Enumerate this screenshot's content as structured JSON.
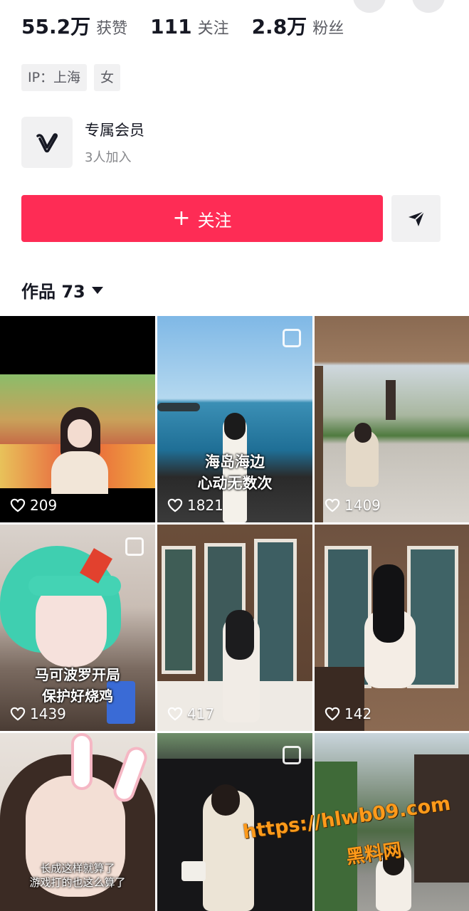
{
  "stats": [
    {
      "value": "55.2万",
      "label": "获赞"
    },
    {
      "value": "111",
      "label": "关注"
    },
    {
      "value": "2.8万",
      "label": "粉丝"
    }
  ],
  "tags": [
    "IP：上海",
    "女"
  ],
  "member": {
    "title": "专属会员",
    "subtitle": "3人加入"
  },
  "follow_label": "关注",
  "works": {
    "label": "作品 73"
  },
  "tiles": [
    {
      "likes": "209"
    },
    {
      "likes": "1821",
      "caption": [
        "海岛海边",
        "心动无数次"
      ]
    },
    {
      "likes": "1409"
    },
    {
      "likes": "1439",
      "caption": [
        "马可波罗开局",
        "保护好烧鸡"
      ]
    },
    {
      "likes": "417"
    },
    {
      "likes": "142"
    },
    {
      "caption": [
        "长成这样就算了",
        "游戏打的也这么算了"
      ]
    },
    {},
    {}
  ],
  "watermark": {
    "url": "https://hlwb09.com",
    "name": "黑料网"
  },
  "colors": {
    "accent": "#fe2c55",
    "watermark": "#ff9a1a"
  }
}
